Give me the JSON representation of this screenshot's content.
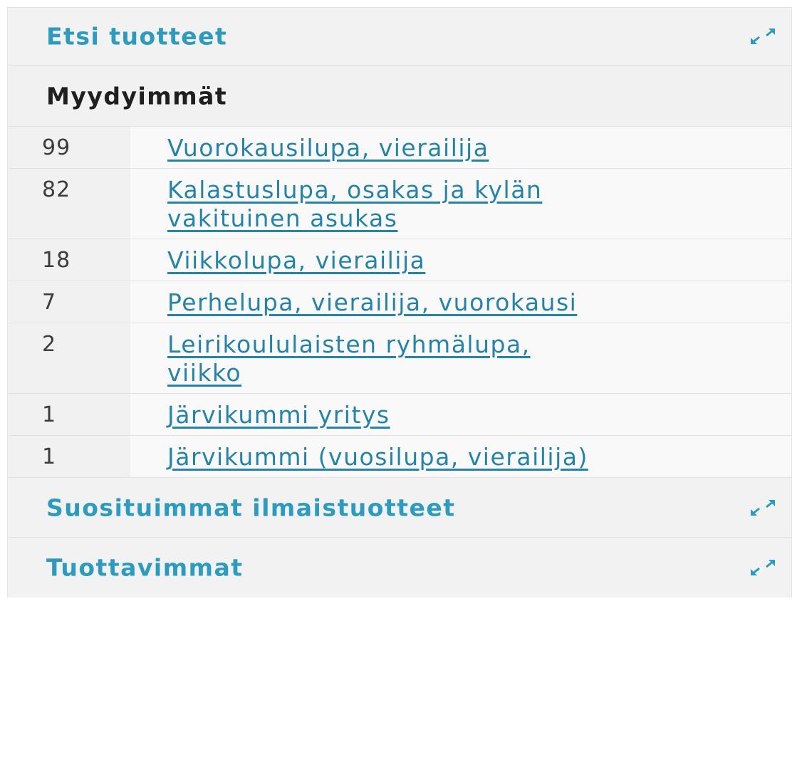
{
  "sections": {
    "search_products": {
      "label": "Etsi tuotteet",
      "icon": "expand-icon"
    },
    "bestsellers": {
      "title": "Myydyimmät",
      "rows": [
        {
          "count": "99",
          "product": "Vuorokausilupa, vierailija"
        },
        {
          "count": "82",
          "product": "Kalastuslupa, osakas ja kylän vakituinen asukas"
        },
        {
          "count": "18",
          "product": "Viikkolupa, vierailija"
        },
        {
          "count": "7",
          "product": "Perhelupa, vierailija, vuorokausi"
        },
        {
          "count": "2",
          "product": "Leirikoululaisten ryhmälupa, viikko"
        },
        {
          "count": "1",
          "product": "Järvikummi yritys"
        },
        {
          "count": "1",
          "product": "Järvikummi (vuosilupa, vierailija)"
        }
      ]
    },
    "popular_free": {
      "label": "Suosituimmat ilmaistuotteet",
      "icon": "expand-icon"
    },
    "most_profitable": {
      "label": "Tuottavimmat",
      "icon": "expand-icon"
    }
  },
  "colors": {
    "link": "#2683a8",
    "section_link": "#2d9bbe",
    "panel_background": "#f2f2f2"
  }
}
